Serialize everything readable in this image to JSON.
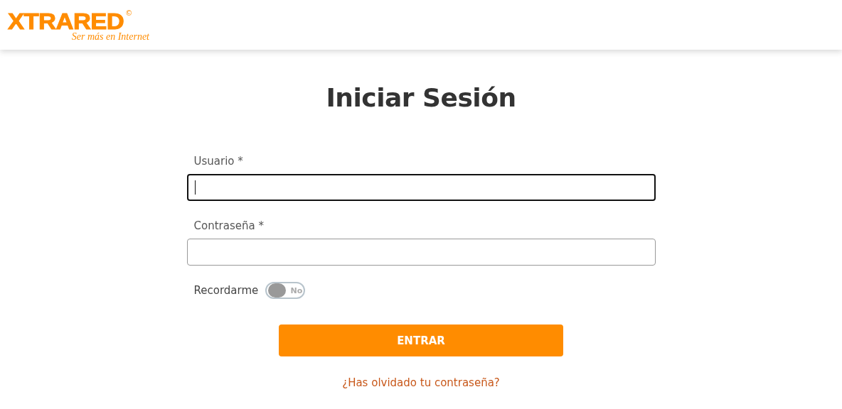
{
  "header": {
    "logo": {
      "name": "XTRARED",
      "mark": "©",
      "tagline": "Ser más en Internet"
    }
  },
  "title": "Iniciar Sesión",
  "fields": [
    {
      "label": "Usuario *",
      "focused": true
    },
    {
      "label": "Contraseña *",
      "focused": false
    }
  ],
  "remember": {
    "label": "Recordarme",
    "on": false,
    "state_text": "No"
  },
  "submit": "ENTRAR",
  "forgot_link": "¿Has olvidado tu contraseña?"
}
